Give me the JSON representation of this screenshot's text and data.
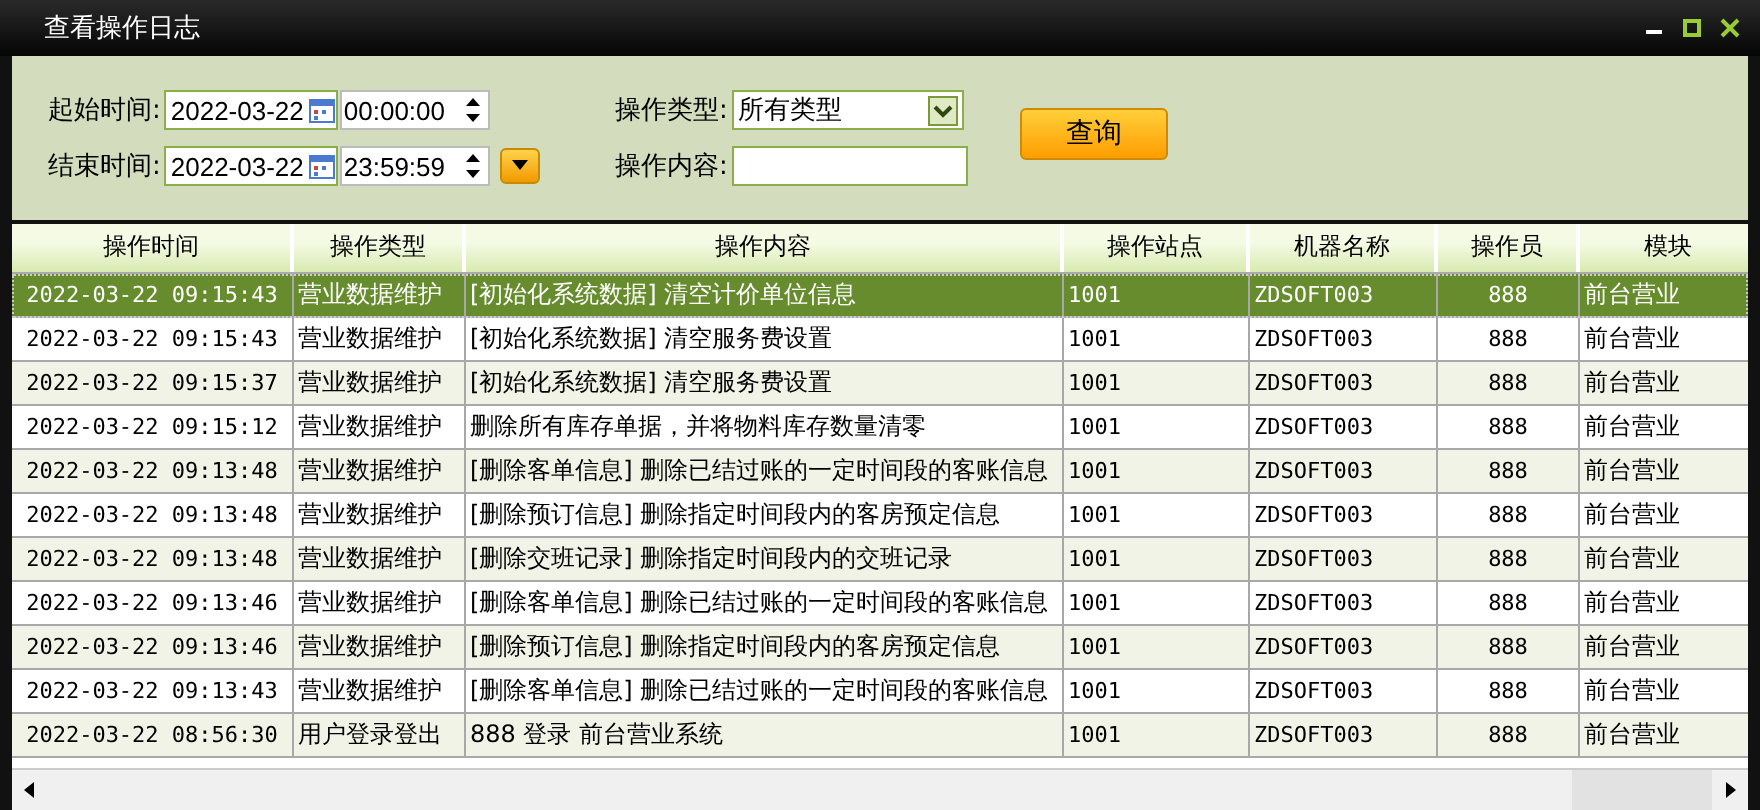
{
  "window": {
    "title": "查看操作日志"
  },
  "filters": {
    "start_label": "起始时间:",
    "start_date": "2022-03-22",
    "start_time": "00:00:00",
    "end_label": "结束时间:",
    "end_date": "2022-03-22",
    "end_time": "23:59:59",
    "type_label": "操作类型:",
    "type_value": "所有类型",
    "content_label": "操作内容:",
    "query_button": "查询"
  },
  "table": {
    "columns": [
      "操作时间",
      "操作类型",
      "操作内容",
      "操作站点",
      "机器名称",
      "操作员",
      "模块"
    ],
    "rows": [
      {
        "selected": true,
        "cells": [
          "2022-03-22  09:15:43",
          "营业数据维护",
          "[初始化系统数据] 清空计价单位信息",
          "1001",
          "ZDSOFT003",
          "888",
          "前台营业"
        ]
      },
      {
        "selected": false,
        "cells": [
          "2022-03-22  09:15:43",
          "营业数据维护",
          "[初始化系统数据] 清空服务费设置",
          "1001",
          "ZDSOFT003",
          "888",
          "前台营业"
        ]
      },
      {
        "selected": false,
        "cells": [
          "2022-03-22  09:15:37",
          "营业数据维护",
          "[初始化系统数据] 清空服务费设置",
          "1001",
          "ZDSOFT003",
          "888",
          "前台营业"
        ]
      },
      {
        "selected": false,
        "cells": [
          "2022-03-22  09:15:12",
          "营业数据维护",
          "删除所有库存单据，并将物料库存数量清零",
          "1001",
          "ZDSOFT003",
          "888",
          "前台营业"
        ]
      },
      {
        "selected": false,
        "cells": [
          "2022-03-22  09:13:48",
          "营业数据维护",
          "[删除客单信息] 删除已结过账的一定时间段的客账信息",
          "1001",
          "ZDSOFT003",
          "888",
          "前台营业"
        ]
      },
      {
        "selected": false,
        "cells": [
          "2022-03-22  09:13:48",
          "营业数据维护",
          "[删除预订信息] 删除指定时间段内的客房预定信息",
          "1001",
          "ZDSOFT003",
          "888",
          "前台营业"
        ]
      },
      {
        "selected": false,
        "cells": [
          "2022-03-22  09:13:48",
          "营业数据维护",
          "[删除交班记录] 删除指定时间段内的交班记录",
          "1001",
          "ZDSOFT003",
          "888",
          "前台营业"
        ]
      },
      {
        "selected": false,
        "cells": [
          "2022-03-22  09:13:46",
          "营业数据维护",
          "[删除客单信息] 删除已结过账的一定时间段的客账信息",
          "1001",
          "ZDSOFT003",
          "888",
          "前台营业"
        ]
      },
      {
        "selected": false,
        "cells": [
          "2022-03-22  09:13:46",
          "营业数据维护",
          "[删除预订信息] 删除指定时间段内的客房预定信息",
          "1001",
          "ZDSOFT003",
          "888",
          "前台营业"
        ]
      },
      {
        "selected": false,
        "cells": [
          "2022-03-22  09:13:43",
          "营业数据维护",
          "[删除客单信息] 删除已结过账的一定时间段的客账信息",
          "1001",
          "ZDSOFT003",
          "888",
          "前台营业"
        ]
      },
      {
        "selected": false,
        "cells": [
          "2022-03-22  08:56:30",
          "用户登录登出",
          "888 登录 前台营业系统",
          "1001",
          "ZDSOFT003",
          "888",
          "前台营业"
        ]
      }
    ]
  }
}
